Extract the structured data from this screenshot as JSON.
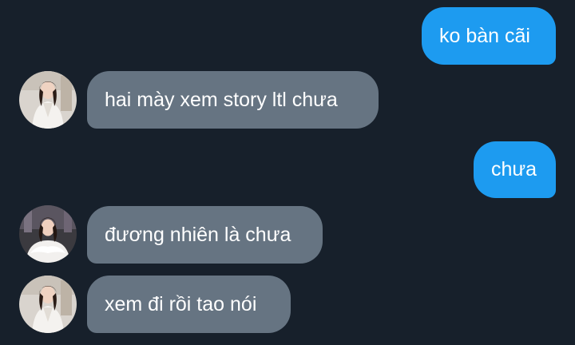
{
  "messages": [
    {
      "direction": "outgoing",
      "text": "ko bàn cãi"
    },
    {
      "direction": "incoming",
      "text": "hai mày xem story ltl chưa",
      "avatar": "profile-photo-white-shirt"
    },
    {
      "direction": "outgoing",
      "text": "chưa"
    },
    {
      "direction": "incoming",
      "text": "đương nhiên là chưa",
      "avatar": "profile-photo-fur-outfit"
    },
    {
      "direction": "incoming",
      "text": "xem đi rồi tao nói",
      "avatar": "profile-photo-white-shirt"
    }
  ],
  "colors": {
    "background": "#17202b",
    "outgoing_bubble": "#1d9bf0",
    "incoming_bubble": "#667482",
    "text": "#ffffff"
  }
}
